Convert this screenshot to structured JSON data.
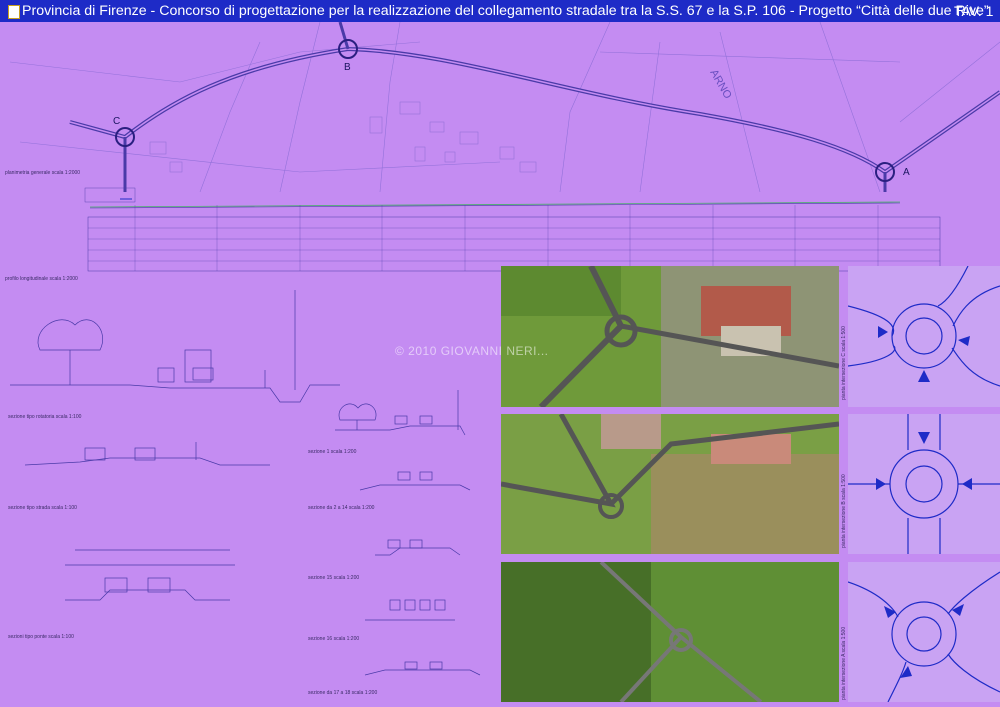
{
  "header": {
    "title": "Provincia di Firenze - Concorso di progettazione per la realizzazione del collegamento stradale tra la S.S. 67 e la S.P. 106 - Progetto “Città delle due Rive”",
    "sheet": "TAV. 1"
  },
  "plan": {
    "caption": "planimetria generale scala 1:2000",
    "points": {
      "a": "A",
      "b": "B",
      "c": "C"
    }
  },
  "profile": {
    "caption": "profilo longitudinale scala 1:2000"
  },
  "sections": {
    "rotatoria": "sezione tipo rotatoria scala 1:100",
    "strada": "sezione tipo strada scala 1:100",
    "ponte": "sezioni tipo ponte scala 1:100",
    "s1": "sezione 1 scala 1:200",
    "s2_14": "sezione da 2 a 14 scala 1:200",
    "s15": "sezione 15 scala 1:200",
    "s16": "sezione 16 scala 1:200",
    "s17_18": "sezione da 17 a 18 scala 1:200"
  },
  "details": {
    "c": "pianta intersezione C scala 1:500",
    "b": "pianta intersezione B scala 1:500",
    "a": "pianta intersezione A scala 1:500"
  },
  "watermark": "© 2010 GIOVANNI NERI...",
  "colors": {
    "background": "#c48cf2",
    "title_bar": "#1e2bc7",
    "linework": "#4a3aa8"
  }
}
